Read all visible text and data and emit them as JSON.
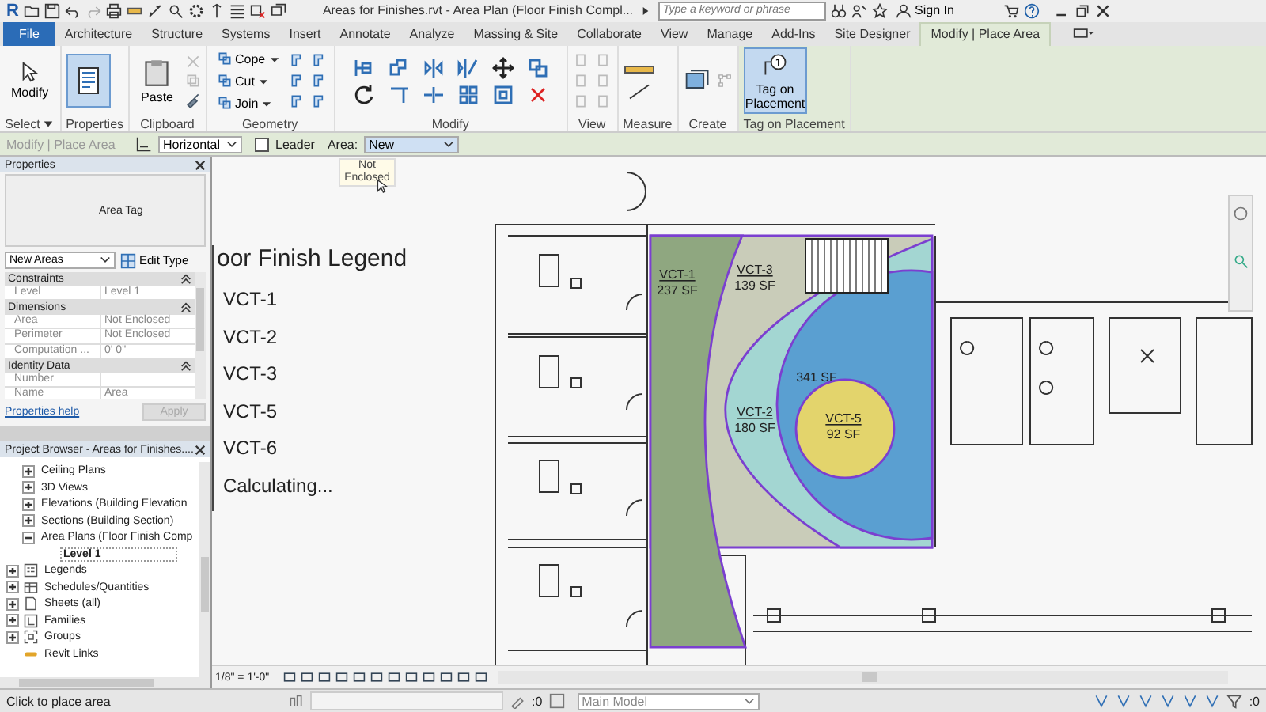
{
  "title_bar": {
    "logo": "R",
    "title": "Areas for Finishes.rvt - Area Plan (Floor Finish Compl...",
    "search_placeholder": "Type a keyword or phrase",
    "sign_in": "Sign In"
  },
  "tabs": [
    {
      "label": "File",
      "kind": "file",
      "selected": false
    },
    {
      "label": "Architecture",
      "kind": "tab",
      "selected": false
    },
    {
      "label": "Structure",
      "kind": "tab",
      "selected": false
    },
    {
      "label": "Systems",
      "kind": "tab",
      "selected": false
    },
    {
      "label": "Insert",
      "kind": "tab",
      "selected": false
    },
    {
      "label": "Annotate",
      "kind": "tab",
      "selected": false
    },
    {
      "label": "Analyze",
      "kind": "tab",
      "selected": false
    },
    {
      "label": "Massing & Site",
      "kind": "tab",
      "selected": false
    },
    {
      "label": "Collaborate",
      "kind": "tab",
      "selected": false
    },
    {
      "label": "View",
      "kind": "tab",
      "selected": false
    },
    {
      "label": "Manage",
      "kind": "tab",
      "selected": false
    },
    {
      "label": "Add-Ins",
      "kind": "tab",
      "selected": false
    },
    {
      "label": "Site Designer",
      "kind": "tab",
      "selected": false
    },
    {
      "label": "Modify | Place Area",
      "kind": "tab",
      "selected": true
    }
  ],
  "ribbon": [
    {
      "label": "Select",
      "kind": "select",
      "buttons": [
        {
          "label": "Modify",
          "on": false
        }
      ]
    },
    {
      "label": "Properties",
      "kind": "properties",
      "buttons": [
        {
          "on": true
        }
      ]
    },
    {
      "label": "Clipboard",
      "kind": "clipboard",
      "buttons": [
        {
          "label": "Paste",
          "on": false
        }
      ]
    },
    {
      "label": "Geometry",
      "kind": "geometry",
      "buttons": [
        {
          "label": "Cope",
          "on": false
        },
        {
          "label": "Cut",
          "on": false
        },
        {
          "label": "Join",
          "on": false
        }
      ]
    },
    {
      "label": "Modify",
      "kind": "modify"
    },
    {
      "label": "View",
      "kind": "view"
    },
    {
      "label": "Measure",
      "kind": "measure"
    },
    {
      "label": "Create",
      "kind": "create"
    },
    {
      "label": "Tag on Placement",
      "kind": "tag",
      "buttons": [
        {
          "label": "Tag on Placement",
          "badge": "1",
          "on": true
        }
      ]
    }
  ],
  "options_bar": {
    "context": "Modify | Place Area",
    "orientation": "Horizontal",
    "leader": {
      "label": "Leader",
      "checked": false
    },
    "area_label": "Area:",
    "area_value": "New"
  },
  "properties": {
    "title": "Properties",
    "type_name": "Area Tag",
    "selector": "New Areas",
    "edit_type": "Edit Type",
    "groups": [
      {
        "name": "Constraints",
        "rows": [
          {
            "name": "Level",
            "value": "Level 1"
          }
        ]
      },
      {
        "name": "Dimensions",
        "rows": [
          {
            "name": "Area",
            "value": "Not Enclosed"
          },
          {
            "name": "Perimeter",
            "value": "Not Enclosed"
          },
          {
            "name": "Computation ...",
            "value": "0' 0\""
          }
        ]
      },
      {
        "name": "Identity Data",
        "rows": [
          {
            "name": "Number"
          },
          {
            "name": "Name",
            "value": "Area"
          }
        ]
      }
    ],
    "help": "Properties help",
    "apply": "Apply"
  },
  "project_browser": {
    "title": "Project Browser - Areas for Finishes....",
    "view_items": [
      {
        "label": "Ceiling Plans",
        "expanded": false,
        "selected": false
      },
      {
        "label": "3D Views",
        "expanded": false,
        "selected": false
      },
      {
        "label": "Elevations (Building Elevation",
        "expanded": false,
        "selected": false
      },
      {
        "label": "Sections (Building Section)",
        "expanded": false,
        "selected": false
      },
      {
        "label": "Area Plans (Floor Finish Comp",
        "expanded": true,
        "selected": false,
        "children": [
          {
            "label": "Level 1",
            "selected": true
          }
        ]
      }
    ],
    "items": [
      {
        "label": "Legends",
        "kind": "legend",
        "expanded": false,
        "selected": false
      },
      {
        "label": "Schedules/Quantities",
        "kind": "schedule",
        "expanded": false,
        "selected": false
      },
      {
        "label": "Sheets (all)",
        "kind": "sheet",
        "expanded": false,
        "selected": false
      },
      {
        "label": "Families",
        "kind": "family",
        "expanded": false,
        "selected": false
      },
      {
        "label": "Groups",
        "kind": "group",
        "expanded": false,
        "selected": false
      },
      {
        "label": "Revit Links",
        "kind": "link",
        "selected": false
      }
    ]
  },
  "canvas": {
    "cursor_tooltip": "Not Enclosed",
    "legend": {
      "title": "oor Finish Legend",
      "entries": [
        "VCT-1",
        "VCT-2",
        "VCT-3",
        "VCT-5",
        "VCT-6",
        "Calculating..."
      ]
    },
    "areas": [
      {
        "name": "VCT-3",
        "area": "139 SF",
        "color": "#c9ccb9"
      },
      {
        "name": "VCT-2",
        "area": "180 SF",
        "color": "#a3d6d2"
      },
      {
        "area": "341 SF",
        "color": "#5a9fd1"
      },
      {
        "name": "VCT-1",
        "area": "237 SF",
        "color": "#8fa780"
      },
      {
        "name": "VCT-5",
        "area": "92 SF",
        "color": "#e3d46c"
      }
    ]
  },
  "view_bar": {
    "scale": "1/8\" = 1'-0\""
  },
  "status_bar": {
    "message": "Click to place area",
    "worksets_count": ":0",
    "model": "Main Model",
    "filters_count": ":0"
  }
}
